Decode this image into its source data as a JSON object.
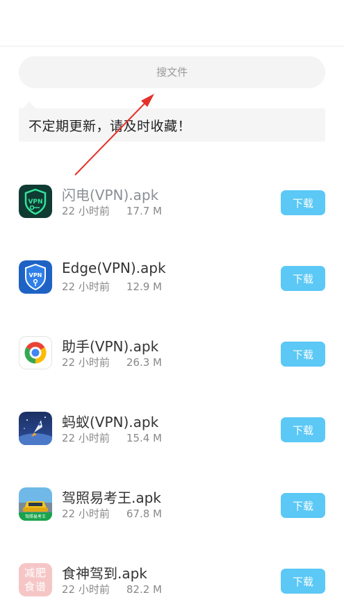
{
  "search": {
    "placeholder": "搜文件"
  },
  "notice": {
    "text": "不定期更新，请及时收藏！"
  },
  "colors": {
    "accent": "#5bc8f5",
    "arrow": "#e5302a"
  },
  "files": [
    {
      "name": "闪电(VPN).apk",
      "time": "22 小时前",
      "size": "17.7 M",
      "action": "下载",
      "icon": "vpn-key-icon"
    },
    {
      "name": "Edge(VPN).apk",
      "time": "22 小时前",
      "size": "12.9 M",
      "action": "下载",
      "icon": "vpn-shield-icon"
    },
    {
      "name": "助手(VPN).apk",
      "time": "22 小时前",
      "size": "26.3 M",
      "action": "下载",
      "icon": "google-icon"
    },
    {
      "name": "蚂蚁(VPN).apk",
      "time": "22 小时前",
      "size": "15.4 M",
      "action": "下载",
      "icon": "rocket-icon"
    },
    {
      "name": "驾照易考王.apk",
      "time": "22 小时前",
      "size": "67.8 M",
      "action": "下载",
      "icon": "car-icon",
      "icon_text": "驾照易考王"
    },
    {
      "name": "食神驾到.apk",
      "time": "22 小时前",
      "size": "82.2 M",
      "action": "下载",
      "icon": "diet-recipe-icon",
      "icon_text": "减肥食谱"
    }
  ]
}
